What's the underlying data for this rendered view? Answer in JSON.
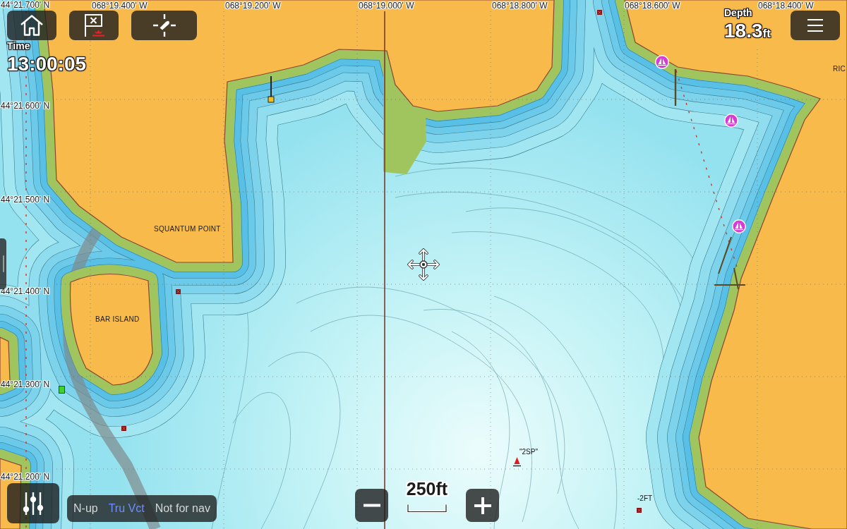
{
  "grid": {
    "longitudes": [
      "068°19.400' W",
      "068°19.200' W",
      "068°19.000' W",
      "068°18.800' W",
      "068°18.600' W",
      "068°18.400' W"
    ],
    "latitudes": [
      "44°21.700' N",
      "44°21.600' N",
      "44°21.500' N",
      "44°21.400' N",
      "44°21.300' N",
      "44°21.200' N"
    ]
  },
  "time": {
    "label": "Time",
    "value": "13:00:05"
  },
  "depth": {
    "label": "Depth",
    "value": "18.3",
    "unit": "ft"
  },
  "chart_labels": [
    {
      "kind": "place",
      "text": "SQUANTUM POINT"
    },
    {
      "kind": "place",
      "text": "BAR ISLAND"
    },
    {
      "kind": "place",
      "text": "RIC"
    },
    {
      "kind": "buoy",
      "text": "\"2SP\""
    },
    {
      "kind": "sounding",
      "text": "-2FT"
    }
  ],
  "scale": {
    "value": "250ft"
  },
  "status_bar": {
    "items": [
      {
        "text": "N-up",
        "highlighted": false
      },
      {
        "text": "Tru Vct",
        "highlighted": true
      },
      {
        "text": "Not for nav",
        "highlighted": false
      }
    ]
  }
}
